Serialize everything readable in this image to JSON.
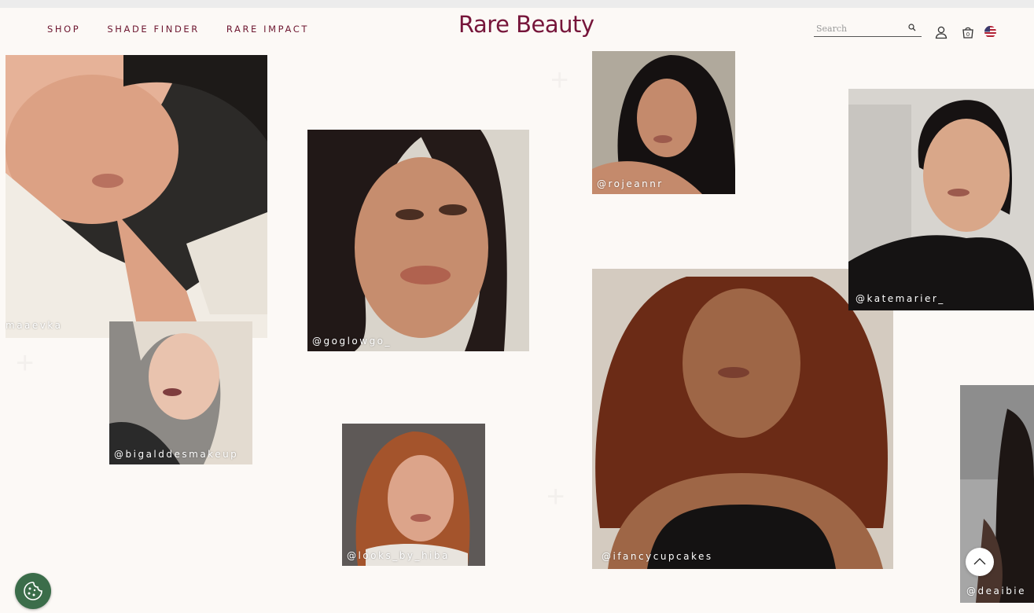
{
  "header": {
    "nav": [
      "SHOP",
      "SHADE FINDER",
      "RARE IMPACT"
    ],
    "logo": "Rare Beauty",
    "search_placeholder": "Search"
  },
  "icons": {
    "search": "search-icon",
    "account": "account-icon",
    "bag": "bag-icon",
    "bag_count": "0",
    "flag": "us-flag-icon",
    "cookie": "cookie-icon",
    "scroll_top": "chevron-up-icon"
  },
  "gallery": [
    {
      "handle": "maaevka"
    },
    {
      "handle": "@bigalddesmakeup"
    },
    {
      "handle": "@goglowgo_"
    },
    {
      "handle": "@looks_by_hiba"
    },
    {
      "handle": "@rojeannr"
    },
    {
      "handle": "@ifancycupcakes"
    },
    {
      "handle": "@katemarier_"
    },
    {
      "handle": "@deaibie"
    }
  ],
  "colors": {
    "brand": "#76153a",
    "background": "#fcf9f6",
    "cookie_button": "#3b6d4a"
  }
}
